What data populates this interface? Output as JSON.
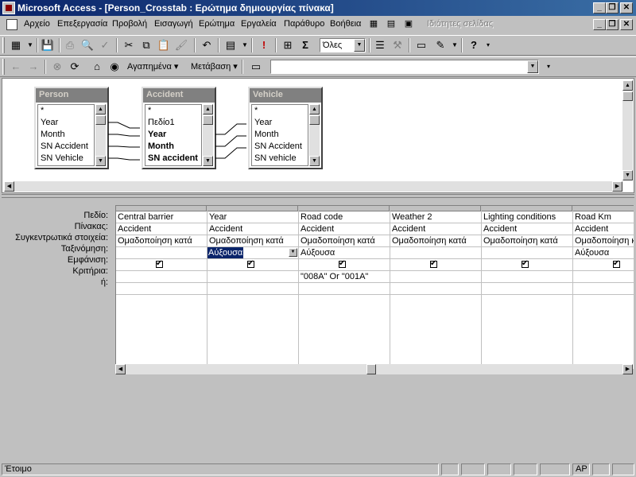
{
  "window": {
    "title": "Microsoft Access - [Person_Crosstab : Ερώτημα δημιουργίας πίνακα]"
  },
  "menu": {
    "items": [
      "Αρχείο",
      "Επεξεργασία",
      "Προβολή",
      "Εισαγωγή",
      "Ερώτημα",
      "Εργαλεία",
      "Παράθυρο",
      "Βοήθεια"
    ],
    "disabled_item": "Ιδιότητες σελίδας"
  },
  "toolbar": {
    "top_values": "Όλες"
  },
  "webbar": {
    "favorites": "Αγαπημένα",
    "goto": "Μετάβαση",
    "address": ""
  },
  "tables": [
    {
      "name": "Person",
      "fields": [
        "*",
        "Year",
        "Month",
        "SN Accident",
        "SN Vehicle"
      ],
      "bold_fields": []
    },
    {
      "name": "Accident",
      "fields": [
        "*",
        "Πεδίο1",
        "Year",
        "Month",
        "SN accident"
      ],
      "bold_fields": [
        2,
        3,
        4
      ]
    },
    {
      "name": "Vehicle",
      "fields": [
        "*",
        "Year",
        "Month",
        "SN Accident",
        "SN vehicle"
      ],
      "bold_fields": []
    }
  ],
  "row_labels": [
    "Πεδίο:",
    "Πίνακας:",
    "Συγκεντρωτικά στοιχεία:",
    "Ταξινόμηση:",
    "Εμφάνιση:",
    "Κριτήρια:",
    "ή:"
  ],
  "columns": [
    {
      "field": "Central barrier",
      "table": "Accident",
      "total": "Ομαδοποίηση κατά",
      "sort": "",
      "show": true,
      "criteria": ""
    },
    {
      "field": "Year",
      "table": "Accident",
      "total": "Ομαδοποίηση κατά",
      "sort": "Αύξουσα",
      "show": true,
      "criteria": ""
    },
    {
      "field": "Road code",
      "table": "Accident",
      "total": "Ομαδοποίηση κατά",
      "sort": "Αύξουσα",
      "show": true,
      "criteria": "\"008A\" Or \"001A\""
    },
    {
      "field": "Weather 2",
      "table": "Accident",
      "total": "Ομαδοποίηση κατά",
      "sort": "",
      "show": true,
      "criteria": ""
    },
    {
      "field": "Lighting conditions",
      "table": "Accident",
      "total": "Ομαδοποίηση κατά",
      "sort": "",
      "show": true,
      "criteria": ""
    },
    {
      "field": "Road Km",
      "table": "Accident",
      "total": "Ομαδοποίηση κατά",
      "sort": "Αύξουσα",
      "show": true,
      "criteria": ""
    }
  ],
  "status": {
    "text": "Έτοιμο",
    "indicator": "ΑΡ"
  }
}
